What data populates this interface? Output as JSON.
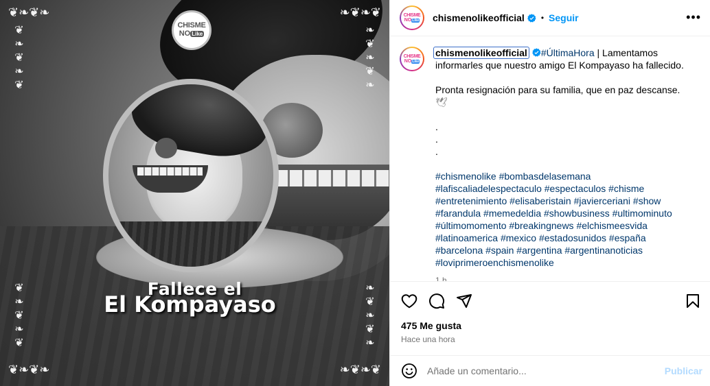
{
  "post_image": {
    "brand_logo_line1": "CHISME",
    "brand_logo_line2": "NO",
    "brand_logo_badge": "Like",
    "headline_line1": "Fallece el",
    "headline_line2": "El Kompayaso"
  },
  "header": {
    "username": "chismenolikeofficial",
    "separator": "•",
    "follow_label": "Seguir",
    "more_label": "•••"
  },
  "avatar": {
    "line1": "CHISME",
    "line2": "NO",
    "badge": "Like"
  },
  "caption": {
    "username": "chismenolikeofficial",
    "hashtag_lead": "#ÚltimaHora",
    "text_1": " | Lamentamos informarles que nuestro amigo El Kompayaso ha fallecido.",
    "text_2": "Pronta resignación para su familia, que en paz descanse.",
    "dove": "🕊",
    "dots": [
      ".",
      ".",
      "."
    ],
    "hashtags": [
      "#chismenolike #bombasdelasemana",
      "#lafiscaliadelespectaculo #espectaculos #chisme",
      "#entretenimiento #elisaberistain #javierceriani #show",
      "#farandula #memedeldia #showbusiness #ultimominuto",
      "#últimomomento #breakingnews #elchismeesvida",
      "#latinoamerica #mexico #estadosunidos #españa",
      "#barcelona #spain #argentina #argentinanoticias",
      "#loviprimeroenchismenolike"
    ],
    "time": "1 h"
  },
  "actions": {
    "icons": [
      "heart-icon",
      "comment-icon",
      "share-icon",
      "bookmark-icon"
    ],
    "likes": "475 Me gusta",
    "time": "Hace una hora"
  },
  "comment_box": {
    "emoji_icon": "emoji-icon",
    "placeholder": "Añade un comentario...",
    "publish_label": "Publicar"
  },
  "colors": {
    "link_blue": "#0095f6",
    "hashtag": "#00376b",
    "muted": "#737373",
    "publish_disabled": "#b3dbff"
  }
}
